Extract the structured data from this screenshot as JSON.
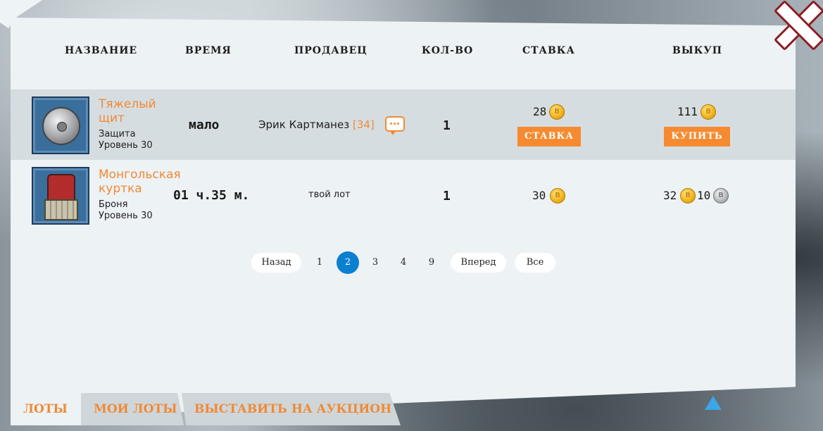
{
  "columns": {
    "name": "НАЗВАНИЕ",
    "time": "ВРЕМЯ",
    "seller": "ПРОДАВЕЦ",
    "qty": "КОЛ-ВО",
    "bid": "СТАВКА",
    "buyout": "ВЫКУП"
  },
  "lots": [
    {
      "name_line1": "Тяжелый",
      "name_line2": "щит",
      "type": "Защита",
      "level": "Уровень 30",
      "time": "мало",
      "seller": "Эрик Картманез",
      "seller_level": "[34]",
      "qty": "1",
      "bid": "28",
      "bid_button": "СТАВКА",
      "buyout": "111",
      "buy_button": "КУПИТЬ",
      "icon": "heavy-shield-icon"
    },
    {
      "name_line1": "Монгольская",
      "name_line2": "куртка",
      "type": "Броня",
      "level": "Уровень 30",
      "time": "01 ч.35 м.",
      "seller": "твой лот",
      "qty": "1",
      "bid": "30",
      "buyout_gold": "32",
      "buyout_silver": "10",
      "icon": "mongol-jacket-icon"
    }
  ],
  "pagination": {
    "prev": "Назад",
    "pages": [
      "1",
      "2",
      "3",
      "4",
      "9"
    ],
    "current": "2",
    "next": "Вперед",
    "all": "Все"
  },
  "tabs": {
    "lots": "ЛОТЫ",
    "my_lots": "МОИ ЛОТЫ",
    "sell": "ВЫСТАВИТЬ НА АУКЦИОН"
  },
  "colors": {
    "accent": "#f68a30",
    "active_page": "#0b7fd0",
    "panel": "#edf2f5",
    "row_shade": "#d6dde1"
  }
}
